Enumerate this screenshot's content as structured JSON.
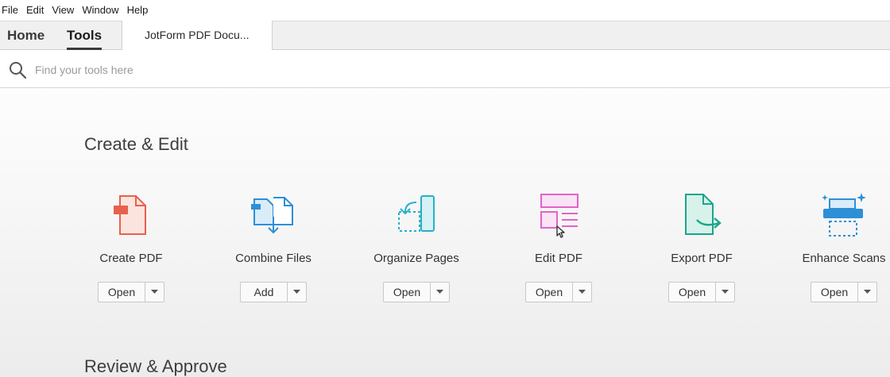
{
  "menu": [
    "File",
    "Edit",
    "View",
    "Window",
    "Help"
  ],
  "tabs": {
    "home": "Home",
    "tools": "Tools",
    "document": "JotForm PDF Docu..."
  },
  "search": {
    "placeholder": "Find your tools here",
    "value": ""
  },
  "sections": {
    "create_edit": "Create & Edit",
    "review_approve": "Review & Approve"
  },
  "tools": [
    {
      "name": "Create PDF",
      "action": "Open",
      "icon": "create-pdf-icon",
      "color": "#e8604c"
    },
    {
      "name": "Combine Files",
      "action": "Add",
      "icon": "combine-files-icon",
      "color": "#2d8fd6"
    },
    {
      "name": "Organize Pages",
      "action": "Open",
      "icon": "organize-pages-icon",
      "color": "#27b0c4"
    },
    {
      "name": "Edit PDF",
      "action": "Open",
      "icon": "edit-pdf-icon",
      "color": "#e063c8"
    },
    {
      "name": "Export PDF",
      "action": "Open",
      "icon": "export-pdf-icon",
      "color": "#1aa58a"
    },
    {
      "name": "Enhance Scans",
      "action": "Open",
      "icon": "enhance-scans-icon",
      "color": "#2d8fd6"
    }
  ]
}
